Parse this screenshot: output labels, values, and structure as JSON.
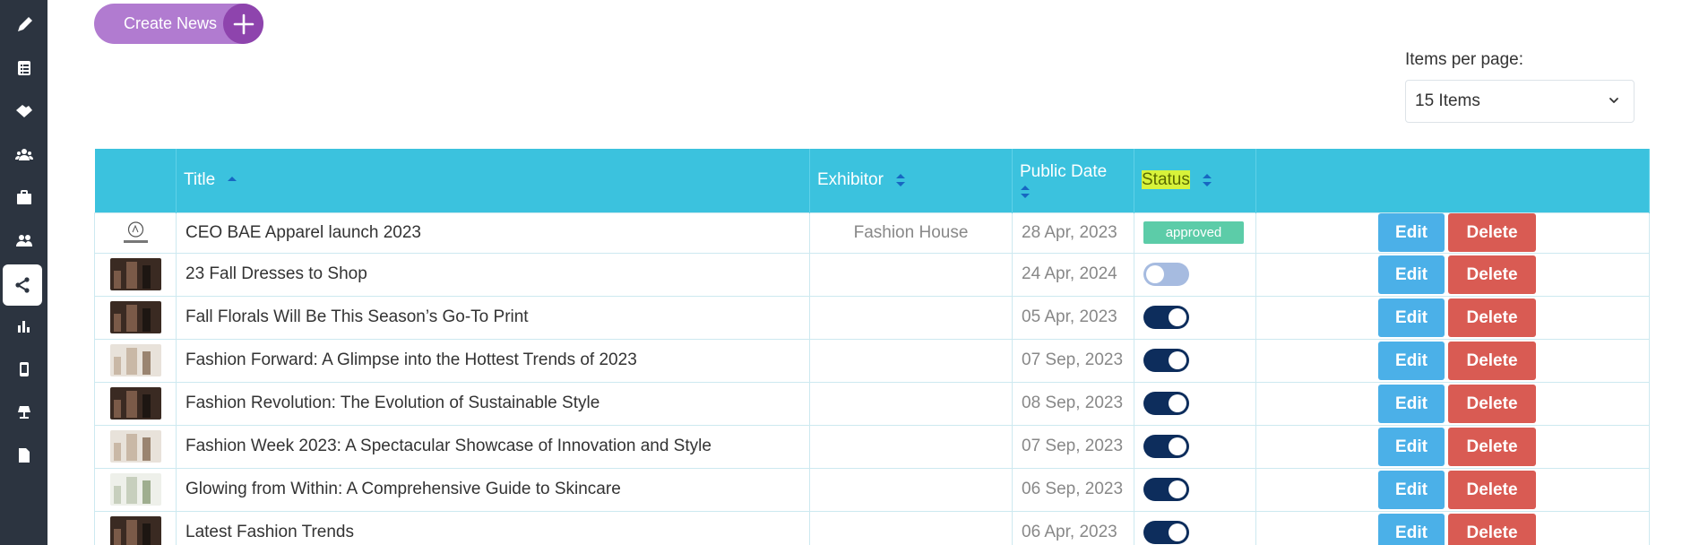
{
  "sidebar": {
    "items": [
      {
        "icon": "pencil-icon"
      },
      {
        "icon": "list-icon"
      },
      {
        "icon": "handshake-icon"
      },
      {
        "icon": "group-icon"
      },
      {
        "icon": "briefcase-icon"
      },
      {
        "icon": "users-icon"
      },
      {
        "icon": "share-icon",
        "active": true
      },
      {
        "icon": "bar-chart-icon"
      },
      {
        "icon": "mobile-icon"
      },
      {
        "icon": "lamp-icon"
      },
      {
        "icon": "document-icon"
      }
    ]
  },
  "toolbar": {
    "create_label": "Create News"
  },
  "pagination": {
    "items_per_page_label": "Items per page:",
    "items_per_page_value": "15 Items"
  },
  "table": {
    "headers": {
      "title": "Title",
      "exhibitor": "Exhibitor",
      "public_date": "Public Date",
      "status": "Status"
    },
    "rows": [
      {
        "title": "CEO BAE Apparel launch 2023",
        "exhibitor": "Fashion House",
        "date": "28 Apr, 2023",
        "status": "approved",
        "status_type": "badge",
        "thumb": "logo"
      },
      {
        "title": "23 Fall Dresses to Shop",
        "exhibitor": "",
        "date": "24 Apr, 2024",
        "status_type": "toggle",
        "enabled": false,
        "thumb": "dark"
      },
      {
        "title": "Fall Florals Will Be This Season’s Go-To Print",
        "exhibitor": "",
        "date": "05 Apr, 2023",
        "status_type": "toggle",
        "enabled": true,
        "thumb": "dark"
      },
      {
        "title": "Fashion Forward: A Glimpse into the Hottest Trends of 2023",
        "exhibitor": "",
        "date": "07 Sep, 2023",
        "status_type": "toggle",
        "enabled": true,
        "thumb": "light"
      },
      {
        "title": "Fashion Revolution: The Evolution of Sustainable Style",
        "exhibitor": "",
        "date": "08 Sep, 2023",
        "status_type": "toggle",
        "enabled": true,
        "thumb": "dark"
      },
      {
        "title": "Fashion Week 2023: A Spectacular Showcase of Innovation and Style",
        "exhibitor": "",
        "date": "07 Sep, 2023",
        "status_type": "toggle",
        "enabled": true,
        "thumb": "light"
      },
      {
        "title": "Glowing from Within: A Comprehensive Guide to Skincare",
        "exhibitor": "",
        "date": "06 Sep, 2023",
        "status_type": "toggle",
        "enabled": true,
        "thumb": "pale"
      },
      {
        "title": "Latest Fashion Trends",
        "exhibitor": "",
        "date": "06 Apr, 2023",
        "status_type": "toggle",
        "enabled": true,
        "thumb": "dark"
      }
    ],
    "edit_label": "Edit",
    "delete_label": "Delete"
  },
  "colors": {
    "sidebar": "#2c3440",
    "header": "#3bc2de",
    "create_button": "#b17bd0",
    "create_plus": "#8e44ad",
    "edit": "#4bb0e8",
    "delete": "#d95b53",
    "approved": "#5ccca8",
    "toggle_on": "#0d2d5c",
    "toggle_off": "#a6bbe0"
  }
}
